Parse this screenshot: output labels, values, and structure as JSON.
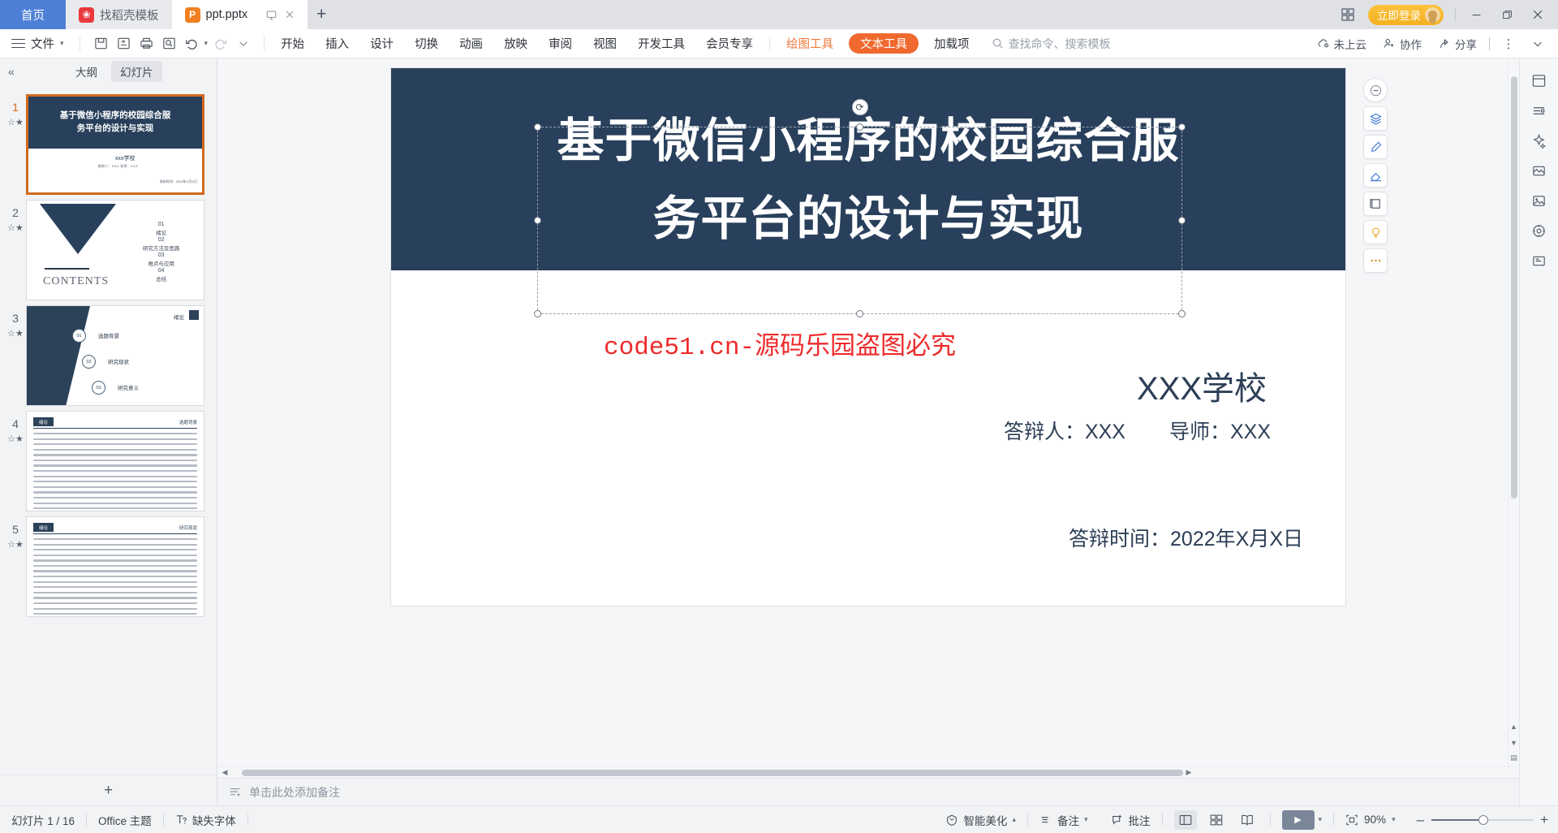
{
  "window": {
    "tabs": [
      {
        "label": "首页",
        "type": "home"
      },
      {
        "label": "找稻壳模板",
        "type": "inactive",
        "icon": "dock-template-icon"
      },
      {
        "label": "ppt.pptx",
        "type": "active",
        "icon": "powerpoint-icon"
      }
    ],
    "new_tab_label": "+",
    "login_label": "立即登录",
    "controls": {
      "minimize": "—",
      "restore": "❐",
      "close": "✕"
    }
  },
  "ribbon": {
    "file_label": "文件",
    "quick_access": [
      "save-icon",
      "save-as-cloud-icon",
      "print-icon",
      "print-preview-icon",
      "undo-icon",
      "redo-icon",
      "customize-icon"
    ],
    "menus": [
      {
        "label": "开始"
      },
      {
        "label": "插入"
      },
      {
        "label": "设计"
      },
      {
        "label": "切换"
      },
      {
        "label": "动画"
      },
      {
        "label": "放映"
      },
      {
        "label": "审阅"
      },
      {
        "label": "视图"
      },
      {
        "label": "开发工具"
      },
      {
        "label": "会员专享"
      }
    ],
    "context_tabs": [
      {
        "label": "绘图工具",
        "style": "orange-text"
      },
      {
        "label": "文本工具",
        "style": "orange-pill"
      }
    ],
    "addin_label": "加载项",
    "search_placeholder": "查找命令、搜索模板",
    "right_actions": [
      {
        "label": "未上云",
        "icon": "cloud-off-icon"
      },
      {
        "label": "协作",
        "icon": "collaborate-icon"
      },
      {
        "label": "分享",
        "icon": "share-icon"
      }
    ]
  },
  "left_panel": {
    "collapse_label": "«",
    "tabs": [
      {
        "label": "大纲",
        "selected": false
      },
      {
        "label": "幻灯片",
        "selected": true
      }
    ],
    "add_slide_label": "+",
    "slides": [
      {
        "number": "1",
        "selected": true,
        "title_line1": "基于微信小程序的校园综合服",
        "title_line2": "务平台的设计与实现",
        "school": "xxx学校",
        "people": "答辩人：XXX      导师：XXX",
        "date": "答辩时间：2022年X月X日"
      },
      {
        "number": "2",
        "selected": false,
        "contents_label": "CONTENTS",
        "toc": [
          {
            "num": "01",
            "label": "绪论"
          },
          {
            "num": "02",
            "label": "研究方法及思路"
          },
          {
            "num": "03",
            "label": "难点与应用"
          },
          {
            "num": "04",
            "label": "总结"
          }
        ]
      },
      {
        "number": "3",
        "selected": false,
        "header": "绪论",
        "items": [
          {
            "num": "01",
            "label": "选题背景"
          },
          {
            "num": "02",
            "label": "研究现状"
          },
          {
            "num": "03",
            "label": "研究意义"
          }
        ]
      },
      {
        "number": "4",
        "selected": false,
        "tag": "绪论",
        "tag_right": "选题背景"
      },
      {
        "number": "5",
        "selected": false,
        "tag": "绪论",
        "tag_right": "研究现状"
      }
    ]
  },
  "slide": {
    "title_line1": "基于微信小程序的校园综合服",
    "title_line2": "务平台的设计与实现",
    "watermark": "code51.cn-源码乐园盗图必究",
    "school": "XXX学校",
    "presenter": "答辩人：XXX",
    "advisor": "导师：XXX",
    "date": "答辩时间：2022年X月X日",
    "colors": {
      "header_bg": "#29405c",
      "title_text": "#ffffff",
      "body_text": "#2c3e55",
      "watermark": "#ee2b2b"
    }
  },
  "canvas_tools": [
    {
      "name": "hide-toolbar-icon"
    },
    {
      "name": "layers-icon"
    },
    {
      "name": "brush-icon"
    },
    {
      "name": "eraser-icon"
    },
    {
      "name": "frame-icon"
    },
    {
      "name": "idea-bulb-icon"
    },
    {
      "name": "more-options-icon"
    }
  ],
  "right_strip": [
    {
      "name": "select-pane-icon"
    },
    {
      "name": "align-icon"
    },
    {
      "name": "ai-magic-icon"
    },
    {
      "name": "shape-format-icon"
    },
    {
      "name": "picture-icon"
    },
    {
      "name": "design-ideas-icon"
    },
    {
      "name": "fullscreen-preview-icon"
    }
  ],
  "notes": {
    "placeholder": "单击此处添加备注",
    "icon": "add-note-icon"
  },
  "status_bar": {
    "slide_counter": "幻灯片 1 / 16",
    "theme": "Office 主题",
    "missing_font": "缺失字体",
    "beautify": "智能美化",
    "notes_btn": "备注",
    "comment_btn": "批注",
    "views": [
      "normal-view-icon",
      "slide-sorter-icon",
      "reading-view-icon"
    ],
    "play_label": "▶",
    "fit_icon": "fit-to-window-icon",
    "zoom_level": "90%",
    "zoom_minus": "–",
    "zoom_plus": "+"
  }
}
